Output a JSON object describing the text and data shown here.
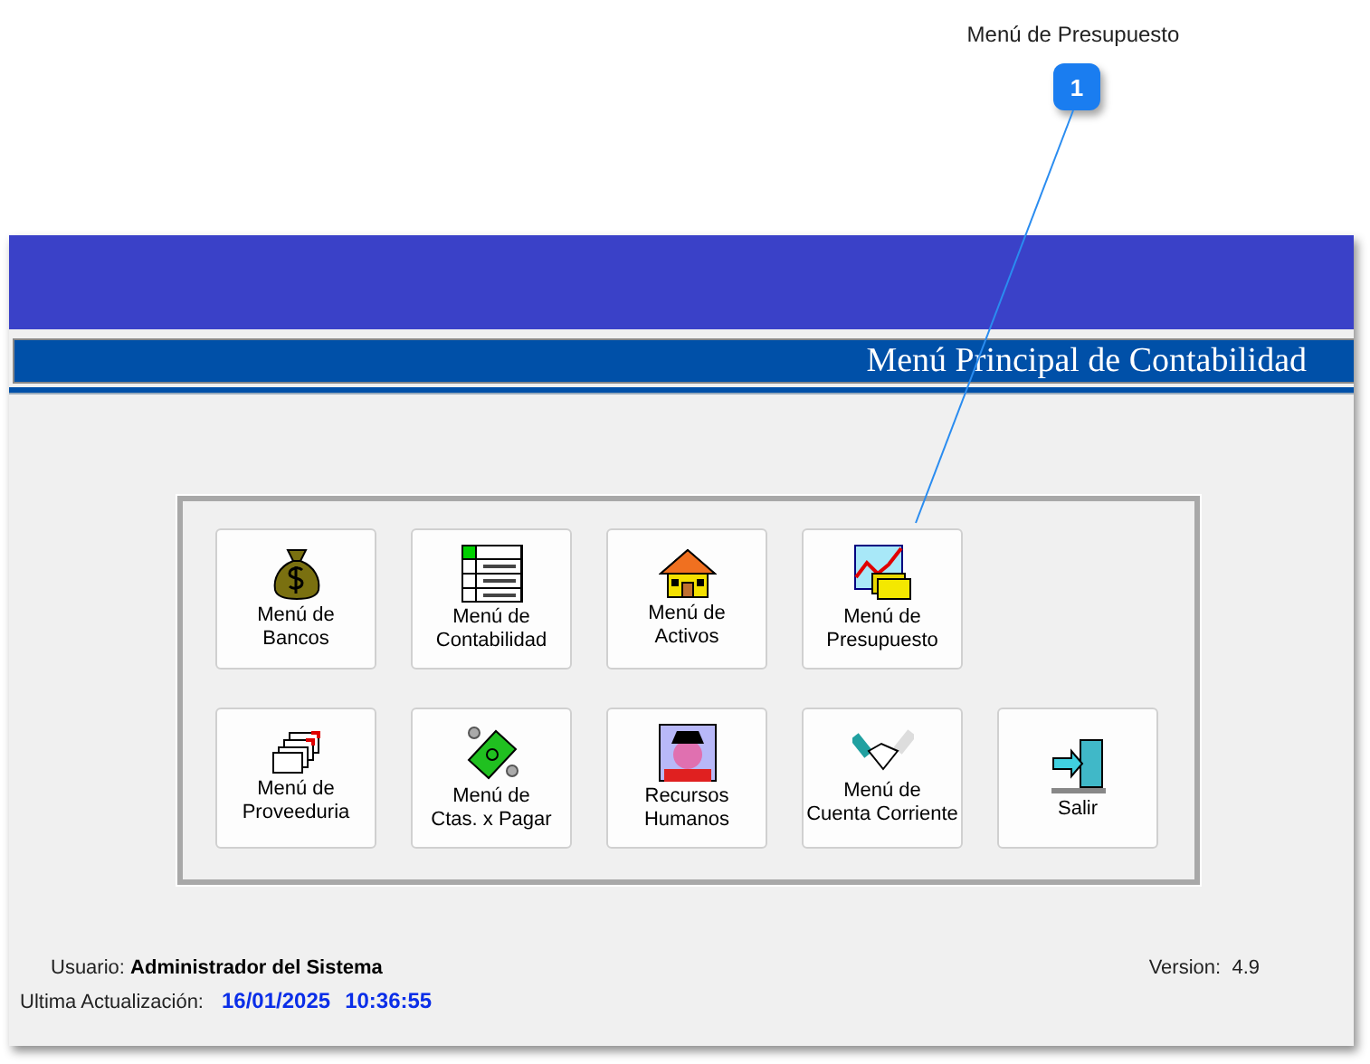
{
  "callout": {
    "label": "Menú de Presupuesto",
    "number": "1"
  },
  "window": {
    "title": "Menú Principal de Contabilidad"
  },
  "menu_buttons": [
    {
      "label": "Menú de\nBancos"
    },
    {
      "label": "Menú de\nContabilidad"
    },
    {
      "label": "Menú de\nActivos"
    },
    {
      "label": "Menú de\nPresupuesto"
    },
    {
      "label": "Menú de\nProveeduria"
    },
    {
      "label": "Menú de\nCtas. x Pagar"
    },
    {
      "label": "Recursos\nHumanos"
    },
    {
      "label": "Menú de\nCuenta Corriente"
    },
    {
      "label": "Salir"
    }
  ],
  "status": {
    "user_label": "Usuario:",
    "user": "Administrador del Sistema",
    "version_label": "Version:",
    "version": "4.9",
    "updated_label": "Ultima Actualización:",
    "date": "16/01/2025",
    "time": "10:36:55"
  }
}
